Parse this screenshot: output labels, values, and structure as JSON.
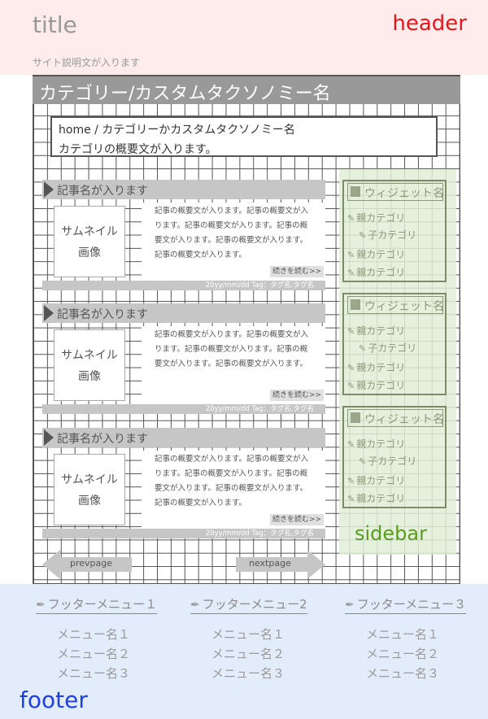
{
  "header": {
    "site_title": "title",
    "site_description": "サイト説明文が入ります",
    "zone_label": "header"
  },
  "category": {
    "title": "カテゴリー/カスタムタクソノミー名",
    "breadcrumb": "home / カテゴリーかカスタムタクソノミー名",
    "description": "カテゴリの概要文が入ります。"
  },
  "articles": [
    {
      "title": "記事名が入ります",
      "thumbnail_line1": "サムネイル",
      "thumbnail_line2": "画像",
      "excerpt": "記事の概要文が入ります。記事の概要文が入ります。記事の概要文が入ります。記事の概要文が入ります。記事の概要文が入ります。記事の概要文が入ります。",
      "read_more": "続きを読む>>",
      "meta": "20yy/mm/dd  Tag：タグ名,タグ名"
    },
    {
      "title": "記事名が入ります",
      "thumbnail_line1": "サムネイル",
      "thumbnail_line2": "画像",
      "excerpt": "記事の概要文が入ります。記事の概要文が入ります。記事の概要文が入ります。記事の概要文が入ります。記事の概要文が入ります。",
      "read_more": "続きを読む>>",
      "meta": "20yy/mm/dd  Tag：タグ名,タグ名"
    },
    {
      "title": "記事名が入ります",
      "thumbnail_line1": "サムネイル",
      "thumbnail_line2": "画像",
      "excerpt": "記事の概要文が入ります。記事の概要文が入ります。記事の概要文が入ります。記事の概要文が入ります。記事の概要文が入ります。記事の概要文が入ります。",
      "read_more": "続きを読む>>",
      "meta": "20yy/mm/dd  Tag：タグ名,タグ名"
    }
  ],
  "pagination": {
    "prev": "prevpage",
    "next": "nextpage"
  },
  "sidebar": {
    "zone_label": "sidebar",
    "widgets": [
      {
        "title": "ウィジェット名",
        "items": [
          "親カテゴリ",
          "子カテゴリ",
          "親カテゴリ",
          "親カテゴリ"
        ]
      },
      {
        "title": "ウィジェット名",
        "items": [
          "親カテゴリ",
          "子カテゴリ",
          "親カテゴリ",
          "親カテゴリ"
        ]
      },
      {
        "title": "ウィジェット名",
        "items": [
          "親カテゴリ",
          "子カテゴリ",
          "親カテゴリ",
          "親カテゴリ"
        ]
      }
    ]
  },
  "footer": {
    "zone_label": "footer",
    "menus": [
      {
        "heading": "フッターメニュー１",
        "items": [
          "メニュー名１",
          "メニュー名２",
          "メニュー名３"
        ]
      },
      {
        "heading": "フッターメニュー2",
        "items": [
          "メニュー名１",
          "メニュー名２",
          "メニュー名３"
        ]
      },
      {
        "heading": "フッターメニュー３",
        "items": [
          "メニュー名１",
          "メニュー名２",
          "メニュー名３"
        ]
      }
    ]
  },
  "colors": {
    "header_zone": "#fdeceb",
    "header_label": "#e8141c",
    "sidebar_zone": "#dfeed6",
    "sidebar_label": "#5a9a1e",
    "footer_zone": "#e2ecfb",
    "footer_label": "#1f3fe0",
    "bar_gray": "#c6c6c6",
    "title_bar": "#999999"
  },
  "icons": {
    "article_marker": "triangle-right-icon",
    "widget_marker": "square-icon",
    "widget_item": "pencil-icon",
    "footer_heading": "feather-icon",
    "pager_prev": "arrow-left-icon",
    "pager_next": "arrow-right-icon"
  }
}
